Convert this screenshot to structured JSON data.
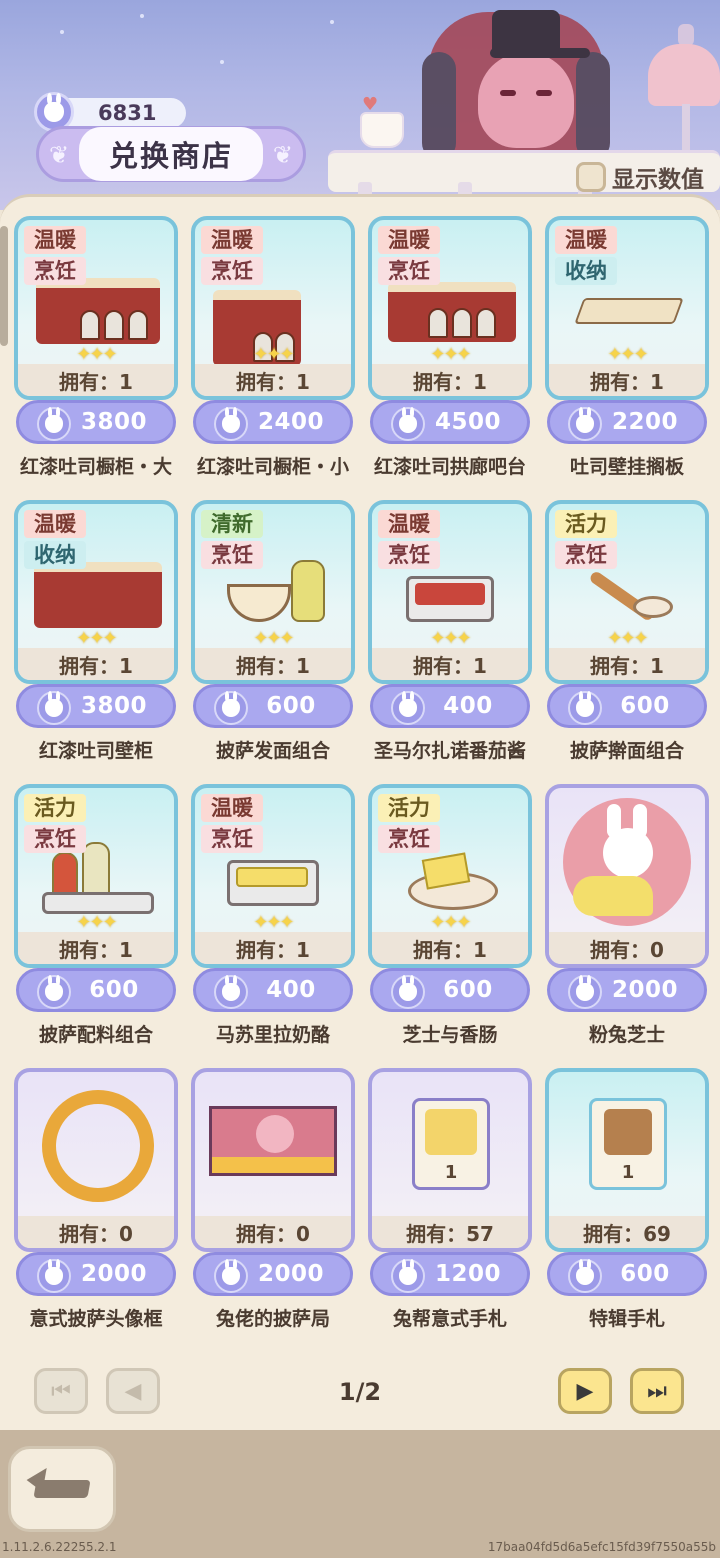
{
  "header": {
    "currency_amount": "6831",
    "shop_title": "兑换商店",
    "show_values_label": "显示数值"
  },
  "items": [
    {
      "tags": [
        "温暖",
        "烹饪"
      ],
      "owned": "拥有：1",
      "price": "3800",
      "name": "红漆吐司橱柜・大",
      "stars": 3
    },
    {
      "tags": [
        "温暖",
        "烹饪"
      ],
      "owned": "拥有：1",
      "price": "2400",
      "name": "红漆吐司橱柜・小",
      "stars": 3
    },
    {
      "tags": [
        "温暖",
        "烹饪"
      ],
      "owned": "拥有：1",
      "price": "4500",
      "name": "红漆吐司拱廊吧台",
      "stars": 3
    },
    {
      "tags": [
        "温暖",
        "收纳"
      ],
      "owned": "拥有：1",
      "price": "2200",
      "name": "吐司壁挂搁板",
      "stars": 3
    },
    {
      "tags": [
        "温暖",
        "收纳"
      ],
      "owned": "拥有：1",
      "price": "3800",
      "name": "红漆吐司壁柜",
      "stars": 3
    },
    {
      "tags": [
        "清新",
        "烹饪"
      ],
      "owned": "拥有：1",
      "price": "600",
      "name": "披萨发面组合",
      "stars": 3
    },
    {
      "tags": [
        "温暖",
        "烹饪"
      ],
      "owned": "拥有：1",
      "price": "400",
      "name": "圣马尔扎诺番茄酱",
      "stars": 3
    },
    {
      "tags": [
        "活力",
        "烹饪"
      ],
      "owned": "拥有：1",
      "price": "600",
      "name": "披萨擀面组合",
      "stars": 3
    },
    {
      "tags": [
        "活力",
        "烹饪"
      ],
      "owned": "拥有：1",
      "price": "600",
      "name": "披萨配料组合",
      "stars": 3
    },
    {
      "tags": [
        "温暖",
        "烹饪"
      ],
      "owned": "拥有：1",
      "price": "400",
      "name": "马苏里拉奶酪",
      "stars": 3
    },
    {
      "tags": [
        "活力",
        "烹饪"
      ],
      "owned": "拥有：1",
      "price": "600",
      "name": "芝士与香肠",
      "stars": 3
    },
    {
      "tags": [],
      "owned": "拥有：0",
      "price": "2000",
      "name": "粉兔芝士",
      "stars": 0
    },
    {
      "tags": [],
      "owned": "拥有：0",
      "price": "2000",
      "name": "意式披萨头像框",
      "stars": 0
    },
    {
      "tags": [],
      "owned": "拥有：0",
      "price": "2000",
      "name": "兔佬的披萨局",
      "stars": 0
    },
    {
      "tags": [],
      "owned": "拥有：57",
      "price": "1200",
      "name": "兔帮意式手札",
      "stars": 0,
      "qty": "1"
    },
    {
      "tags": [],
      "owned": "拥有：69",
      "price": "600",
      "name": "特辑手札",
      "stars": 0,
      "qty": "1"
    }
  ],
  "pagination": {
    "indicator": "1/2",
    "first_enabled": false,
    "prev_enabled": false,
    "next_enabled": true,
    "last_enabled": true
  },
  "footer": {
    "version": "1.11.2.6.22255.2.1",
    "build_hash": "17baa04fd5d6a5efc15fd39f7550a55b"
  },
  "colors": {
    "tag_warm": "#fbd9d4",
    "tag_cook": "#f9dfe1",
    "tag_store": "#cdeef0",
    "tag_fresh": "#d6f2c8",
    "tag_vital": "#fbf0b6",
    "price_pill": "#aaa8ef",
    "card_border_teal": "#7ac3db",
    "card_border_purple": "#a8a1e2"
  }
}
